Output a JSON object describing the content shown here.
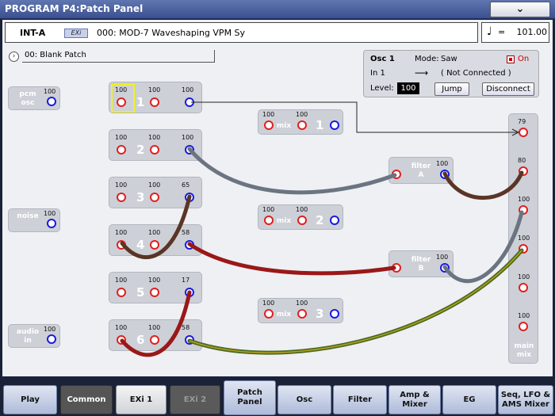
{
  "window": {
    "title": "PROGRAM P4:Patch Panel",
    "menu_icon": "chevron-down-icon",
    "menu_glyph": "⌄"
  },
  "header": {
    "bank": "INT-A",
    "badge": "EXi",
    "program": "000: MOD-7 Waveshaping VPM Sy"
  },
  "tempo": {
    "note_glyph": "♩",
    "equals": "=",
    "value": "101.00"
  },
  "patch": {
    "arrow_glyph": "›",
    "name": "00: Blank Patch"
  },
  "osc_info": {
    "title": "Osc 1",
    "mode_label": "Mode:",
    "mode_value": "Saw",
    "on_label": "On",
    "input_label": "In 1",
    "arrow": "⟶",
    "connection": "( Not Connected )",
    "level_label": "Level:",
    "level_value": "100",
    "jump": "Jump",
    "disconnect": "Disconnect"
  },
  "sources": [
    {
      "name": "pcm\nosc",
      "value": "100"
    },
    {
      "name": "noise",
      "value": "100"
    },
    {
      "name": "audio\nin",
      "value": "100"
    }
  ],
  "oscillators": [
    {
      "num": "1",
      "values": [
        "100",
        "100",
        "100"
      ]
    },
    {
      "num": "2",
      "values": [
        "100",
        "100",
        "100"
      ]
    },
    {
      "num": "3",
      "values": [
        "100",
        "100",
        "65"
      ]
    },
    {
      "num": "4",
      "values": [
        "100",
        "100",
        "58"
      ]
    },
    {
      "num": "5",
      "values": [
        "100",
        "100",
        "17"
      ]
    },
    {
      "num": "6",
      "values": [
        "100",
        "100",
        "58"
      ]
    }
  ],
  "mixers": [
    {
      "label": "mix",
      "num": "1",
      "values": [
        "100",
        "100"
      ]
    },
    {
      "label": "mix",
      "num": "2",
      "values": [
        "100",
        "100"
      ]
    },
    {
      "label": "mix",
      "num": "3",
      "values": [
        "100",
        "100"
      ]
    }
  ],
  "filters": [
    {
      "name": "filter",
      "letter": "A",
      "value": "100"
    },
    {
      "name": "filter",
      "letter": "B",
      "value": "100"
    }
  ],
  "main_mix": {
    "label": "main\nmix",
    "values": [
      "79",
      "80",
      "100",
      "100",
      "100",
      "100"
    ]
  },
  "tabs": [
    {
      "label": "Play"
    },
    {
      "label": "Common"
    },
    {
      "label": "EXi 1"
    },
    {
      "label": "EXi 2"
    },
    {
      "label": "Patch\nPanel"
    },
    {
      "label": "Osc"
    },
    {
      "label": "Filter"
    },
    {
      "label": "Amp &\nMixer"
    },
    {
      "label": "EG"
    },
    {
      "label": "Seq, LFO &\nAMS Mixer"
    }
  ]
}
